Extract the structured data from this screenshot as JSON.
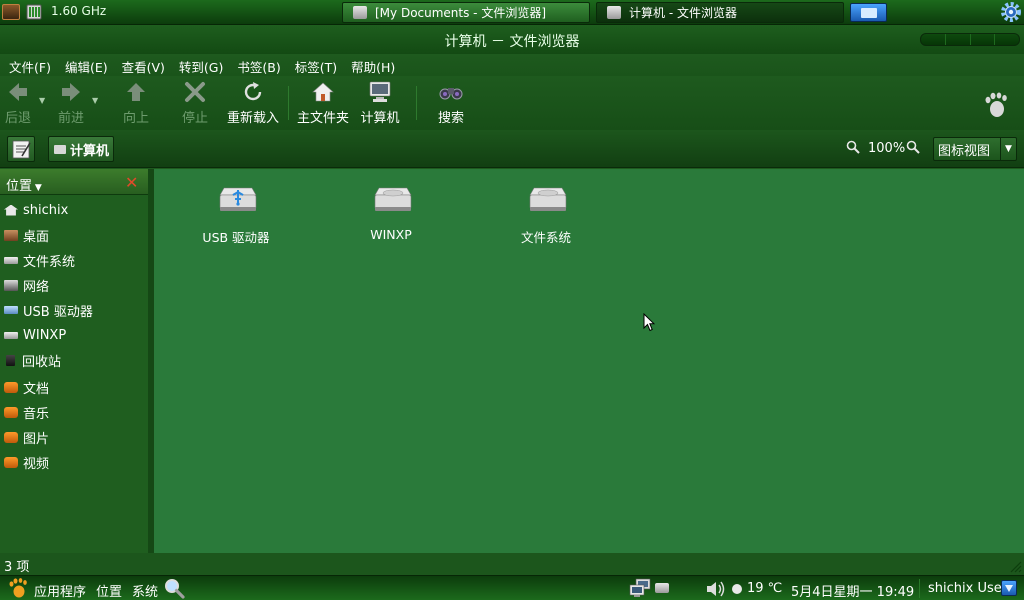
{
  "top_panel": {
    "cpu_freq": "1.60 GHz",
    "tasks": [
      {
        "label": "[My Documents - 文件浏览器]",
        "state": "minimized"
      },
      {
        "label": "计算机 - 文件浏览器",
        "state": "active"
      }
    ],
    "icons": [
      "cpu-icon",
      "battery-icon",
      "show-desktop-icon",
      "gear-icon"
    ]
  },
  "window": {
    "title": "计算机 － 文件浏览器"
  },
  "menubar": {
    "items": [
      "文件(F)",
      "编辑(E)",
      "查看(V)",
      "转到(G)",
      "书签(B)",
      "标签(T)",
      "帮助(H)"
    ]
  },
  "toolbar": {
    "back": "后退",
    "forward": "前进",
    "up": "向上",
    "stop": "停止",
    "reload": "重新载入",
    "home": "主文件夹",
    "computer": "计算机",
    "search": "搜索",
    "disabled": [
      "back",
      "forward",
      "up",
      "stop"
    ]
  },
  "location": {
    "crumb": "计算机",
    "zoom": "100%",
    "view_mode": "图标视图"
  },
  "sidebar": {
    "header": "位置",
    "items": [
      {
        "label": "shichix",
        "icon": "home-icon"
      },
      {
        "label": "桌面",
        "icon": "desktop-icon"
      },
      {
        "label": "文件系统",
        "icon": "drive-icon"
      },
      {
        "label": "网络",
        "icon": "network-icon"
      },
      {
        "label": "USB 驱动器",
        "icon": "usb-drive-icon"
      },
      {
        "label": "WINXP",
        "icon": "drive-icon"
      },
      {
        "label": "回收站",
        "icon": "trash-icon"
      },
      {
        "label": "文档",
        "icon": "folder-icon"
      },
      {
        "label": "音乐",
        "icon": "folder-icon"
      },
      {
        "label": "图片",
        "icon": "folder-icon"
      },
      {
        "label": "视频",
        "icon": "folder-icon"
      }
    ]
  },
  "main": {
    "items": [
      {
        "label": "USB 驱动器",
        "icon": "usb-drive-icon"
      },
      {
        "label": "WINXP",
        "icon": "hard-drive-icon"
      },
      {
        "label": "文件系统",
        "icon": "hard-drive-icon"
      }
    ]
  },
  "statusbar": {
    "text": "3 项"
  },
  "bottom_panel": {
    "applications": "应用程序",
    "places": "位置",
    "system": "系统",
    "temperature": "19 ℃",
    "datetime": "5月4日星期一 19:49",
    "user": "shichix User"
  },
  "colors": {
    "panel": "#1c6a1c",
    "window_bg": "#1e5a1e",
    "main_view": "#2a7a3a",
    "close_x": "#e04a2a",
    "folder": "#ff9a2a",
    "usb_blue": "#4aa4ff"
  }
}
